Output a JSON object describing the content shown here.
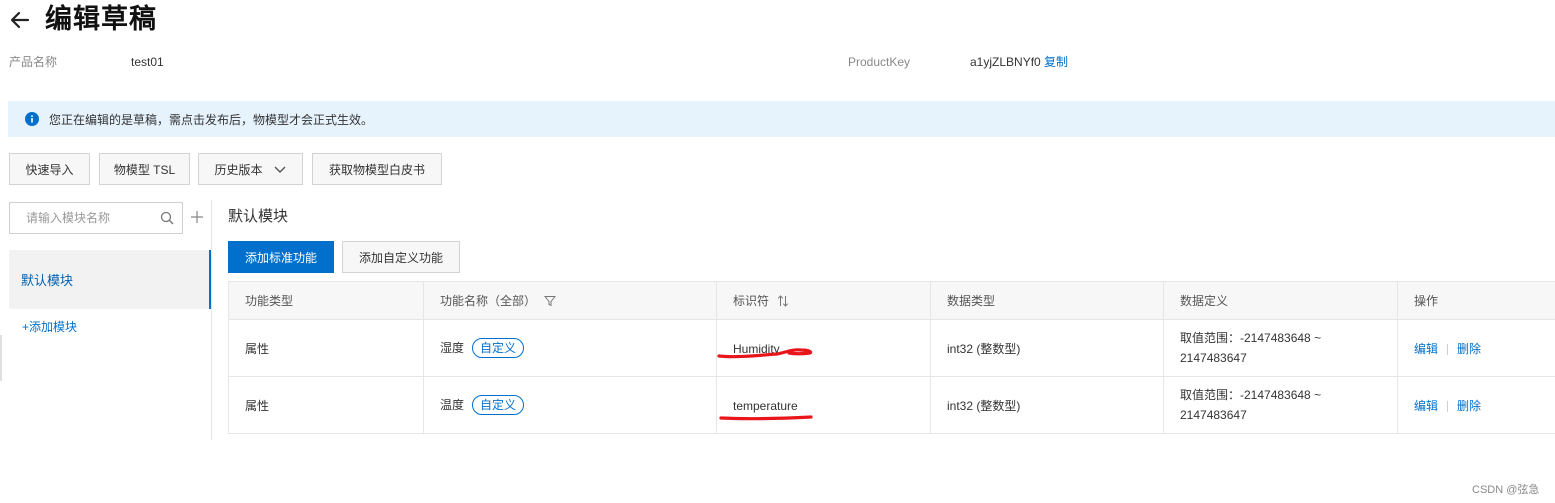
{
  "header": {
    "title": "编辑草稿",
    "back_icon": "arrow-left-icon"
  },
  "product": {
    "name_label": "产品名称",
    "name_value": "test01",
    "key_label": "ProductKey",
    "key_value": "a1yjZLBNYf0",
    "copy_label": "复制"
  },
  "notice": {
    "icon": "info-circle-icon",
    "text": "您正在编辑的是草稿，需点击发布后，物模型才会正式生效。"
  },
  "toolbar": {
    "quick_import": "快速导入",
    "tsl": "物模型 TSL",
    "history": "历史版本",
    "whitepaper": "获取物模型白皮书"
  },
  "sidebar": {
    "search_placeholder": "请输入模块名称",
    "active_module": "默认模块",
    "add_module": "+添加模块"
  },
  "main": {
    "section_title": "默认模块",
    "add_standard": "添加标准功能",
    "add_custom": "添加自定义功能"
  },
  "table": {
    "headers": {
      "type": "功能类型",
      "name": "功能名称（全部）",
      "identifier": "标识符",
      "data_type": "数据类型",
      "data_def": "数据定义",
      "ops": "操作"
    },
    "rows": [
      {
        "type": "属性",
        "name": "湿度",
        "tag": "自定义",
        "identifier": "Humidity",
        "data_type": "int32 (整数型)",
        "data_def": "取值范围：-2147483648 ~ 2147483647",
        "edit": "编辑",
        "delete": "删除"
      },
      {
        "type": "属性",
        "name": "温度",
        "tag": "自定义",
        "identifier": "temperature",
        "data_type": "int32 (整数型)",
        "data_def": "取值范围：-2147483648 ~ 2147483647",
        "edit": "编辑",
        "delete": "删除"
      }
    ]
  },
  "watermark": "CSDN @弦急",
  "colors": {
    "primary": "#0070cc",
    "notice_bg": "#e6f3fd",
    "annotation_red": "#e8161b"
  }
}
